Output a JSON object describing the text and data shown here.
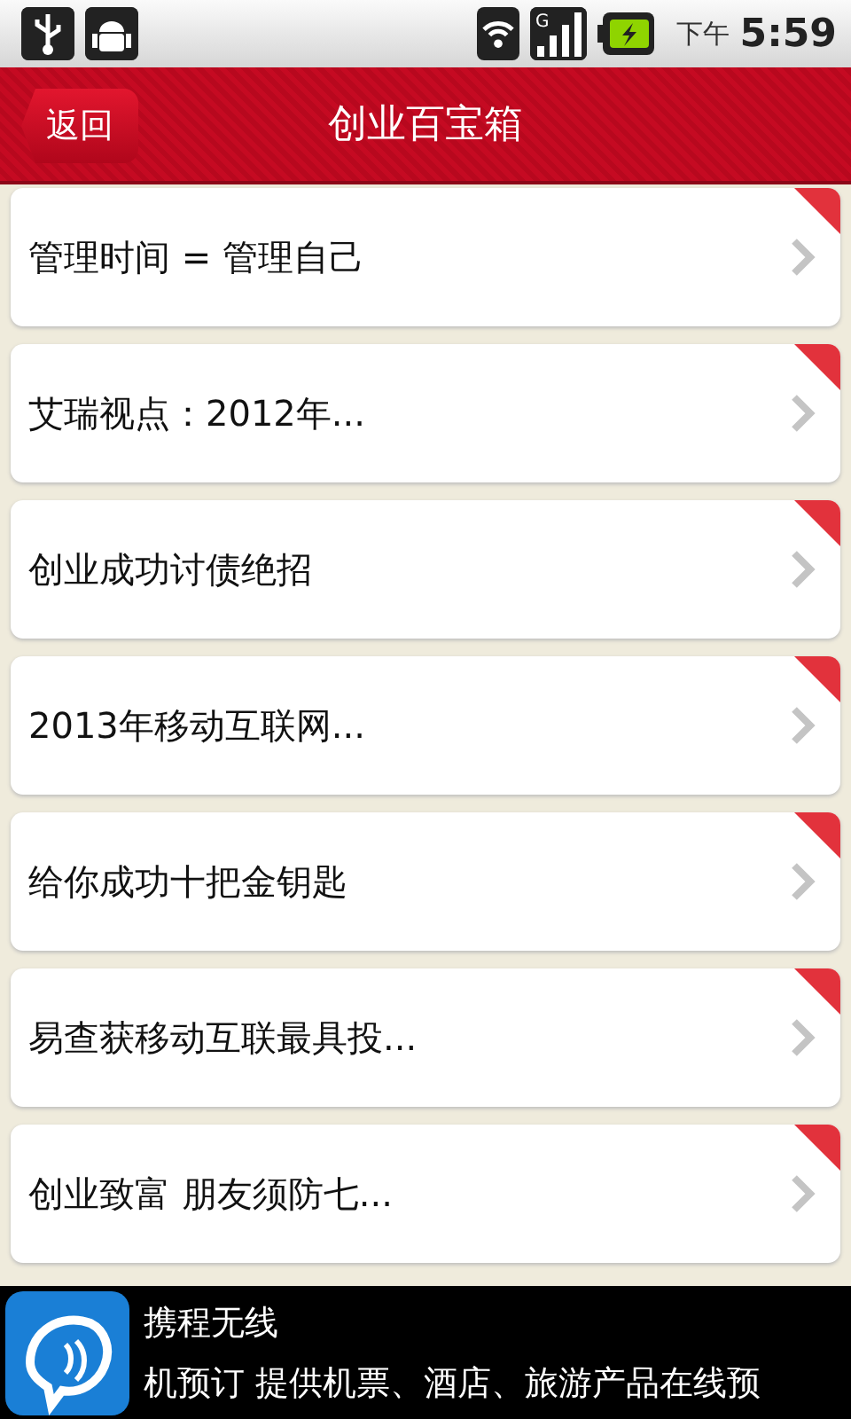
{
  "status_bar": {
    "meridiem": "下午",
    "time": "5:59",
    "signal_label": "G"
  },
  "header": {
    "back": "返回",
    "title": "创业百宝箱"
  },
  "items": [
    {
      "label": "管理时间 = 管理自己"
    },
    {
      "label": "艾瑞视点：2012年..."
    },
    {
      "label": "创业成功讨债绝招"
    },
    {
      "label": "2013年移动互联网..."
    },
    {
      "label": "给你成功十把金钥匙"
    },
    {
      "label": "易查获移动互联最具投..."
    },
    {
      "label": "创业致富 朋友须防七..."
    }
  ],
  "ad": {
    "title": "携程无线",
    "text": "机预订 提供机票、酒店、旅游产品在线预"
  }
}
